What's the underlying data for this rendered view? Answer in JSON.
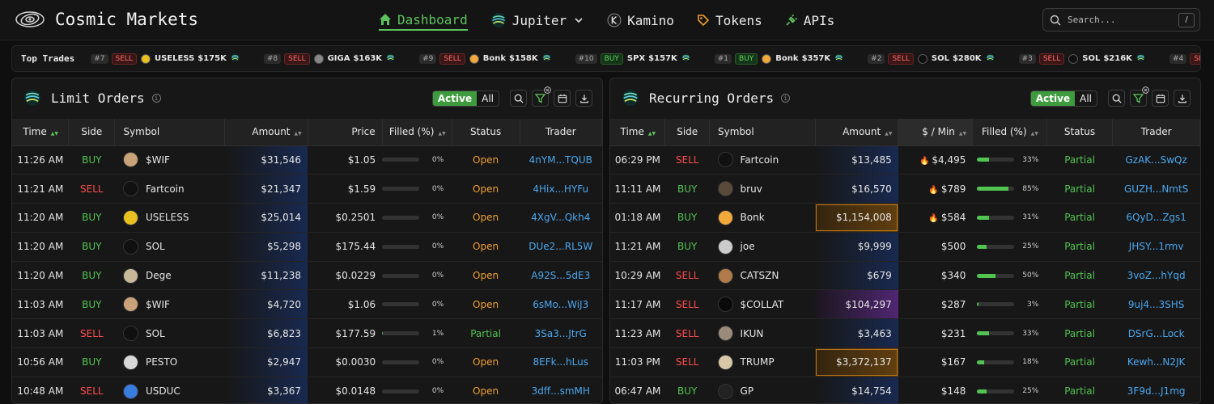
{
  "nav": {
    "brand": "Cosmic Markets",
    "items": [
      {
        "label": "Dashboard",
        "icon": "home-icon",
        "active": true
      },
      {
        "label": "Jupiter",
        "icon": "jupiter-icon",
        "dropdown": true
      },
      {
        "label": "Kamino",
        "icon": "kamino-icon"
      },
      {
        "label": "Tokens",
        "icon": "tag-icon"
      },
      {
        "label": "APIs",
        "icon": "plug-icon"
      }
    ],
    "search_placeholder": "Search...",
    "search_key": "/"
  },
  "ticker": {
    "title": "Top Trades",
    "trades": [
      {
        "rank": "#7",
        "side": "SELL",
        "symbol": "USELESS",
        "amount": "$175K",
        "color": "#e8c020"
      },
      {
        "rank": "#8",
        "side": "SELL",
        "symbol": "GIGA",
        "amount": "$163K",
        "color": "#888888"
      },
      {
        "rank": "#9",
        "side": "SELL",
        "symbol": "Bonk",
        "amount": "$158K",
        "color": "#f2a93b"
      },
      {
        "rank": "#10",
        "side": "BUY",
        "symbol": "SPX",
        "amount": "$157K",
        "color": ""
      },
      {
        "rank": "#1",
        "side": "BUY",
        "symbol": "Bonk",
        "amount": "$357K",
        "color": "#f2a93b"
      },
      {
        "rank": "#2",
        "side": "SELL",
        "symbol": "SOL",
        "amount": "$280K",
        "color": "#101010"
      },
      {
        "rank": "#3",
        "side": "SELL",
        "symbol": "SOL",
        "amount": "$216K",
        "color": "#101010"
      },
      {
        "rank": "#4",
        "side": "SE",
        "symbol": "",
        "amount": "",
        "color": ""
      }
    ]
  },
  "limit": {
    "title": "Limit Orders",
    "filter_active": "Active",
    "filter_all": "All",
    "headers": [
      "Time",
      "Side",
      "Symbol",
      "Amount",
      "Price",
      "Filled (%)",
      "Status",
      "Trader"
    ],
    "rows": [
      {
        "time": "11:26 AM",
        "side": "BUY",
        "symbol": "$WIF",
        "amount": "$31,546",
        "price": "$1.05",
        "filled": 0,
        "filled_label": "0%",
        "status": "Open",
        "trader": "4nYM...TQUB",
        "icon_color": "#c9a27a"
      },
      {
        "time": "11:21 AM",
        "side": "SELL",
        "symbol": "Fartcoin",
        "amount": "$21,347",
        "price": "$1.59",
        "filled": 0,
        "filled_label": "0%",
        "status": "Open",
        "trader": "4Hix...HYFu",
        "icon_color": "#111111"
      },
      {
        "time": "11:20 AM",
        "side": "BUY",
        "symbol": "USELESS",
        "amount": "$25,014",
        "price": "$0.2501",
        "filled": 0,
        "filled_label": "0%",
        "status": "Open",
        "trader": "4XgV...Qkh4",
        "icon_color": "#e8c020"
      },
      {
        "time": "11:20 AM",
        "side": "BUY",
        "symbol": "SOL",
        "amount": "$5,298",
        "price": "$175.44",
        "filled": 0,
        "filled_label": "0%",
        "status": "Open",
        "trader": "DUe2...RL5W",
        "icon_color": "#101010"
      },
      {
        "time": "11:20 AM",
        "side": "BUY",
        "symbol": "Dege",
        "amount": "$11,238",
        "price": "$0.0229",
        "filled": 0,
        "filled_label": "0%",
        "status": "Open",
        "trader": "A92S...5dE3",
        "icon_color": "#c8b89a"
      },
      {
        "time": "11:03 AM",
        "side": "BUY",
        "symbol": "$WIF",
        "amount": "$4,720",
        "price": "$1.06",
        "filled": 0,
        "filled_label": "0%",
        "status": "Open",
        "trader": "6sMo...WiJ3",
        "icon_color": "#c9a27a"
      },
      {
        "time": "11:03 AM",
        "side": "SELL",
        "symbol": "SOL",
        "amount": "$6,823",
        "price": "$177.59",
        "filled": 1,
        "filled_label": "1%",
        "status": "Partial",
        "trader": "3Sa3...JtrG",
        "icon_color": "#101010"
      },
      {
        "time": "10:56 AM",
        "side": "BUY",
        "symbol": "PESTO",
        "amount": "$2,947",
        "price": "$0.0030",
        "filled": 0,
        "filled_label": "0%",
        "status": "Open",
        "trader": "8EFk...hLus",
        "icon_color": "#d8d8d8"
      },
      {
        "time": "10:48 AM",
        "side": "SELL",
        "symbol": "USDUC",
        "amount": "$3,367",
        "price": "$0.0148",
        "filled": 0,
        "filled_label": "0%",
        "status": "Open",
        "trader": "3dff...smMH",
        "icon_color": "#3a7be0"
      }
    ]
  },
  "recurring": {
    "title": "Recurring Orders",
    "filter_active": "Active",
    "filter_all": "All",
    "headers": [
      "Time",
      "Side",
      "Symbol",
      "Amount",
      "$ / Min",
      "Filled (%)",
      "Status",
      "Trader"
    ],
    "rows": [
      {
        "time": "06:29 PM",
        "side": "SELL",
        "symbol": "Fartcoin",
        "amount": "$13,485",
        "rate": "$4,495",
        "hot": true,
        "filled": 33,
        "filled_label": "33%",
        "status": "Partial",
        "trader": "GzAK...SwQz",
        "icon_color": "#111111",
        "highlight": ""
      },
      {
        "time": "11:11 AM",
        "side": "BUY",
        "symbol": "bruv",
        "amount": "$16,570",
        "rate": "$789",
        "hot": true,
        "filled": 85,
        "filled_label": "85%",
        "status": "Partial",
        "trader": "GUZH...NmtS",
        "icon_color": "#5a4a3a",
        "highlight": ""
      },
      {
        "time": "01:18 AM",
        "side": "BUY",
        "symbol": "Bonk",
        "amount": "$1,154,008",
        "rate": "$584",
        "hot": true,
        "filled": 31,
        "filled_label": "31%",
        "status": "Partial",
        "trader": "6QyD...Zgs1",
        "icon_color": "#f2a93b",
        "highlight": "big"
      },
      {
        "time": "11:21 AM",
        "side": "BUY",
        "symbol": "joe",
        "amount": "$9,999",
        "rate": "$500",
        "hot": false,
        "filled": 25,
        "filled_label": "25%",
        "status": "Partial",
        "trader": "JHSY...1rmv",
        "icon_color": "#cccccc",
        "highlight": ""
      },
      {
        "time": "10:29 AM",
        "side": "SELL",
        "symbol": "CATSZN",
        "amount": "$679",
        "rate": "$340",
        "hot": false,
        "filled": 50,
        "filled_label": "50%",
        "status": "Partial",
        "trader": "3voZ...hYqd",
        "icon_color": "#b07a4a",
        "highlight": ""
      },
      {
        "time": "11:17 AM",
        "side": "SELL",
        "symbol": "$COLLAT",
        "amount": "$104,297",
        "rate": "$287",
        "hot": false,
        "filled": 3,
        "filled_label": "3%",
        "status": "Partial",
        "trader": "9uj4...3SHS",
        "icon_color": "#0a0a0a",
        "highlight": "purple"
      },
      {
        "time": "11:23 AM",
        "side": "SELL",
        "symbol": "IKUN",
        "amount": "$3,463",
        "rate": "$231",
        "hot": false,
        "filled": 33,
        "filled_label": "33%",
        "status": "Partial",
        "trader": "DSrG...Lock",
        "icon_color": "#9a8a7a",
        "highlight": ""
      },
      {
        "time": "11:03 PM",
        "side": "SELL",
        "symbol": "TRUMP",
        "amount": "$3,372,137",
        "rate": "$167",
        "hot": false,
        "filled": 18,
        "filled_label": "18%",
        "status": "Partial",
        "trader": "Kewh...N2JK",
        "icon_color": "#d8c8a8",
        "highlight": "big"
      },
      {
        "time": "06:47 AM",
        "side": "BUY",
        "symbol": "GP",
        "amount": "$14,754",
        "rate": "$148",
        "hot": false,
        "filled": 25,
        "filled_label": "25%",
        "status": "Partial",
        "trader": "3F9d...J1mg",
        "icon_color": "#222222",
        "highlight": ""
      }
    ]
  }
}
